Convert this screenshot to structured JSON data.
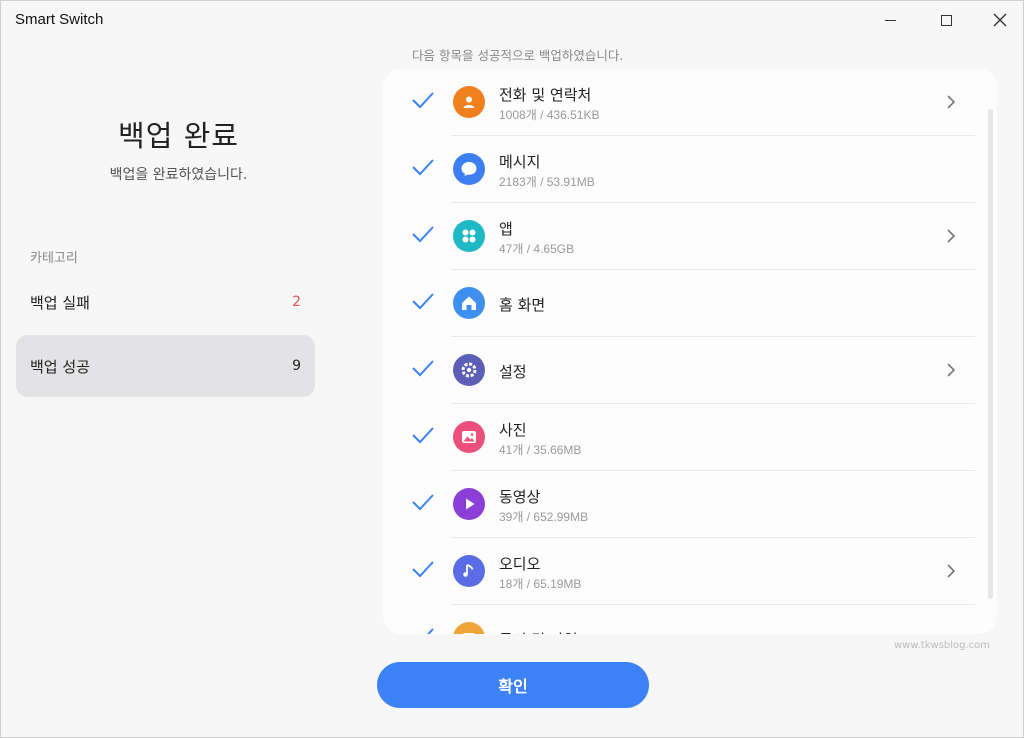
{
  "window": {
    "title": "Smart Switch",
    "minimize_icon": "minimize-icon",
    "maximize_icon": "maximize-icon",
    "close_icon": "close-icon"
  },
  "left": {
    "title": "백업 완료",
    "subtitle": "백업을 완료하였습니다.",
    "category_label": "카테고리",
    "categories": [
      {
        "label": "백업 실패",
        "count": "2",
        "count_color": "#e0554f"
      },
      {
        "label": "백업 성공",
        "count": "9",
        "selected": true
      }
    ]
  },
  "list": {
    "header": "다음 항목을 성공적으로 백업하였습니다.",
    "items": [
      {
        "name": "전화 및 연락처",
        "detail": "1008개 / 436.51KB",
        "icon": "contact-icon",
        "color": "#f0801e",
        "has_chevron": true
      },
      {
        "name": "메시지",
        "detail": "2183개 / 53.91MB",
        "icon": "message-icon",
        "color": "#3d7ef2",
        "has_chevron": false
      },
      {
        "name": "앱",
        "detail": "47개 / 4.65GB",
        "icon": "apps-icon",
        "color": "#1fb8c7",
        "has_chevron": true
      },
      {
        "name": "홈 화면",
        "detail": "",
        "icon": "home-icon",
        "color": "#3f8ff0",
        "has_chevron": false
      },
      {
        "name": "설정",
        "detail": "",
        "icon": "settings-icon",
        "color": "#5c5fb5",
        "has_chevron": true
      },
      {
        "name": "사진",
        "detail": "41개 / 35.66MB",
        "icon": "photo-icon",
        "color": "#ec4f7a",
        "has_chevron": false
      },
      {
        "name": "동영상",
        "detail": "39개 / 652.99MB",
        "icon": "video-icon",
        "color": "#8c3fd6",
        "has_chevron": false
      },
      {
        "name": "오디오",
        "detail": "18개 / 65.19MB",
        "icon": "music-icon",
        "color": "#5b6de6",
        "has_chevron": true
      },
      {
        "name": "문서 및 파일",
        "detail": "",
        "icon": "document-icon",
        "color": "#f0a43a",
        "has_chevron": false
      }
    ],
    "check_color": "#3c82f6"
  },
  "confirm_label": "확인",
  "watermark": "www.tkwsblog.com"
}
